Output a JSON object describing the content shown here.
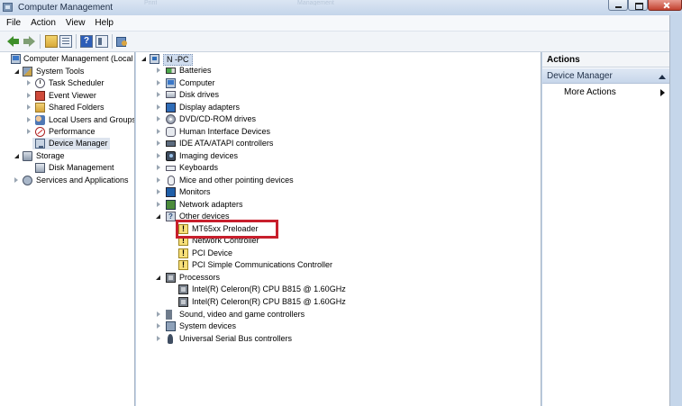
{
  "window": {
    "title": "Computer Management",
    "ghost_tabs": [
      "Print",
      "Management"
    ]
  },
  "menu": [
    "File",
    "Action",
    "View",
    "Help"
  ],
  "toolbar": {
    "help_glyph": "?"
  },
  "left_tree": [
    {
      "label": "Computer Management (Local",
      "level": 0,
      "icon": "computer-icon",
      "expander": "none"
    },
    {
      "label": "System Tools",
      "level": 1,
      "icon": "tools-icon",
      "expander": "open"
    },
    {
      "label": "Task Scheduler",
      "level": 2,
      "icon": "clock-icon",
      "expander": "closed"
    },
    {
      "label": "Event Viewer",
      "level": 2,
      "icon": "event-icon",
      "expander": "closed"
    },
    {
      "label": "Shared Folders",
      "level": 2,
      "icon": "folder-icon",
      "expander": "closed"
    },
    {
      "label": "Local Users and Groups",
      "level": 2,
      "icon": "users-icon",
      "expander": "closed"
    },
    {
      "label": "Performance",
      "level": 2,
      "icon": "performance-icon",
      "expander": "closed"
    },
    {
      "label": "Device Manager",
      "level": 2,
      "icon": "device-manager-icon",
      "expander": "none",
      "selected": true
    },
    {
      "label": "Storage",
      "level": 1,
      "icon": "storage-icon",
      "expander": "open"
    },
    {
      "label": "Disk Management",
      "level": 2,
      "icon": "disk-icon",
      "expander": "none"
    },
    {
      "label": "Services and Applications",
      "level": 1,
      "icon": "services-icon",
      "expander": "closed"
    }
  ],
  "device_tree": {
    "root": {
      "label": "N    -PC",
      "icon": "pc-icon"
    },
    "items": [
      {
        "label": "Batteries",
        "level": 1,
        "icon": "battery-icon",
        "expander": "closed"
      },
      {
        "label": "Computer",
        "level": 1,
        "icon": "computer-icon",
        "expander": "closed"
      },
      {
        "label": "Disk drives",
        "level": 1,
        "icon": "drive-icon",
        "expander": "closed"
      },
      {
        "label": "Display adapters",
        "level": 1,
        "icon": "display-icon",
        "expander": "closed"
      },
      {
        "label": "DVD/CD-ROM drives",
        "level": 1,
        "icon": "dvd-icon",
        "expander": "closed"
      },
      {
        "label": "Human Interface Devices",
        "level": 1,
        "icon": "hid-icon",
        "expander": "closed"
      },
      {
        "label": "IDE ATA/ATAPI controllers",
        "level": 1,
        "icon": "ide-icon",
        "expander": "closed"
      },
      {
        "label": "Imaging devices",
        "level": 1,
        "icon": "camera-icon",
        "expander": "closed"
      },
      {
        "label": "Keyboards",
        "level": 1,
        "icon": "keyboard-icon",
        "expander": "closed"
      },
      {
        "label": "Mice and other pointing devices",
        "level": 1,
        "icon": "mouse-icon",
        "expander": "closed"
      },
      {
        "label": "Monitors",
        "level": 1,
        "icon": "monitor-icon",
        "expander": "closed"
      },
      {
        "label": "Network adapters",
        "level": 1,
        "icon": "network-icon",
        "expander": "closed"
      },
      {
        "label": "Other devices",
        "level": 1,
        "icon": "other-devices-icon",
        "expander": "open"
      },
      {
        "label": "MT65xx Preloader",
        "level": 2,
        "icon": "warning-device-icon",
        "expander": "none"
      },
      {
        "label": "Network Controller",
        "level": 2,
        "icon": "warning-device-icon",
        "expander": "none"
      },
      {
        "label": "PCI Device",
        "level": 2,
        "icon": "warning-device-icon",
        "expander": "none"
      },
      {
        "label": "PCI Simple Communications Controller",
        "level": 2,
        "icon": "warning-device-icon",
        "expander": "none"
      },
      {
        "label": "Processors",
        "level": 1,
        "icon": "processor-icon",
        "expander": "open"
      },
      {
        "label": "Intel(R) Celeron(R) CPU B815 @ 1.60GHz",
        "level": 2,
        "icon": "processor-icon",
        "expander": "none"
      },
      {
        "label": "Intel(R) Celeron(R) CPU B815 @ 1.60GHz",
        "level": 2,
        "icon": "processor-icon",
        "expander": "none"
      },
      {
        "label": "Sound, video and game controllers",
        "level": 1,
        "icon": "sound-icon",
        "expander": "closed"
      },
      {
        "label": "System devices",
        "level": 1,
        "icon": "system-devices-icon",
        "expander": "closed"
      },
      {
        "label": "Universal Serial Bus controllers",
        "level": 1,
        "icon": "usb-icon",
        "expander": "closed"
      }
    ]
  },
  "actions": {
    "title": "Actions",
    "section": "Device Manager",
    "more": "More Actions"
  },
  "colors": {
    "highlight_box": "#c81f2c",
    "chrome": "#c5d6ea"
  }
}
